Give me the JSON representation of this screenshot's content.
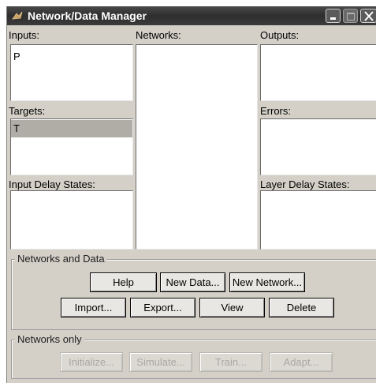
{
  "window": {
    "title": "Network/Data Manager"
  },
  "lists": {
    "inputs": {
      "label": "Inputs:",
      "items": [
        "P"
      ]
    },
    "networks": {
      "label": "Networks:",
      "items": []
    },
    "outputs": {
      "label": "Outputs:",
      "items": []
    },
    "targets": {
      "label": "Targets:",
      "items": [
        "T"
      ],
      "selected": "T"
    },
    "errors": {
      "label": "Errors:",
      "items": []
    },
    "input_delay": {
      "label": "Input Delay States:",
      "items": []
    },
    "layer_delay": {
      "label": "Layer Delay States:",
      "items": []
    }
  },
  "networks_and_data": {
    "title": "Networks and Data",
    "help": "Help",
    "new_data": "New Data...",
    "new_network": "New Network...",
    "import": "Import...",
    "export": "Export...",
    "view": "View",
    "delete": "Delete"
  },
  "networks_only": {
    "title": "Networks only",
    "initialize": "Initialize...",
    "simulate": "Simulate...",
    "train": "Train...",
    "adapt": "Adapt..."
  },
  "colors": {
    "title_bar": "#3a3a3a",
    "window_bg": "#d4d0c8",
    "selection": "#b0ada7"
  }
}
